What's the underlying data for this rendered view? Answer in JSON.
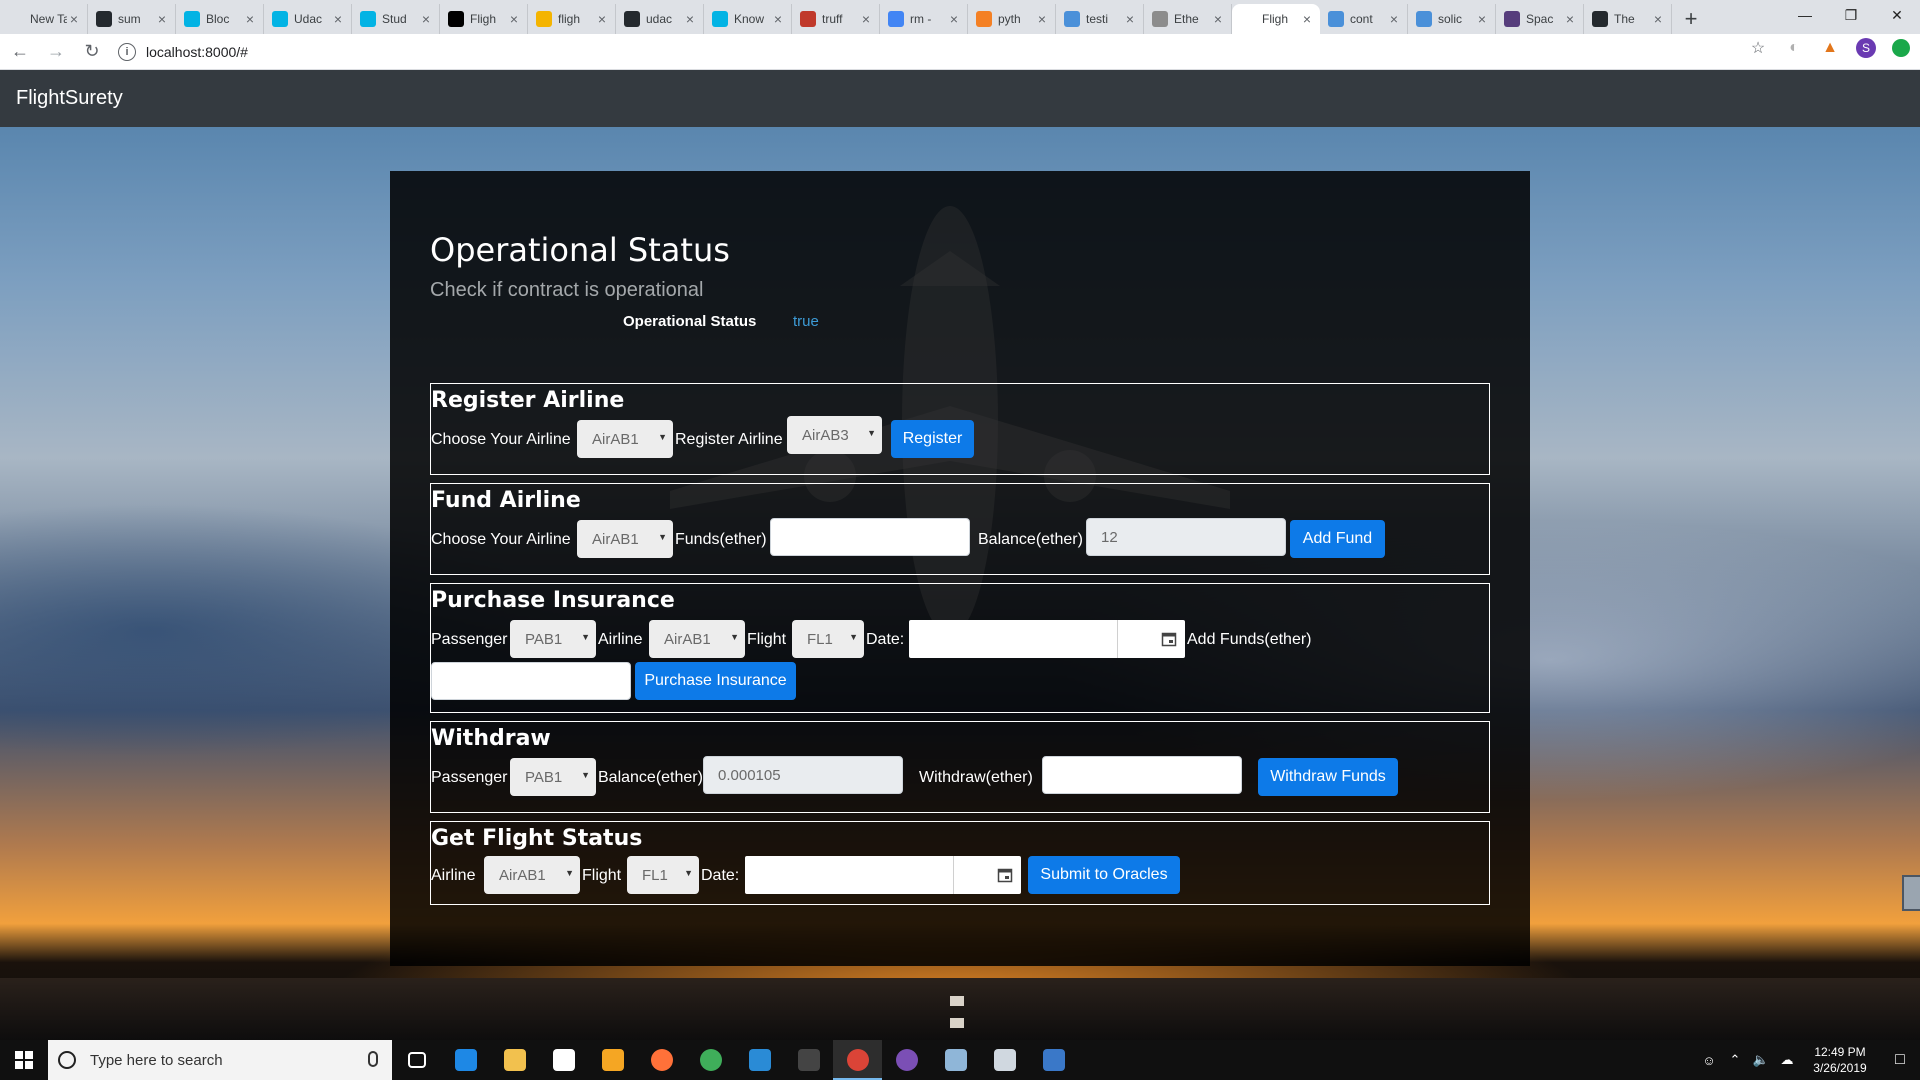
{
  "browser": {
    "tabs": [
      {
        "label": "New Tab",
        "icon": "new-tab-icon",
        "color": "#dee1e6"
      },
      {
        "label": "sum",
        "icon": "github-icon",
        "color": "#24292e"
      },
      {
        "label": "Bloc",
        "icon": "udacity-icon",
        "color": "#02b3e4"
      },
      {
        "label": "Udac",
        "icon": "udacity-icon",
        "color": "#02b3e4"
      },
      {
        "label": "Stud",
        "icon": "udacity-icon",
        "color": "#02b3e4"
      },
      {
        "label": "Fligh",
        "icon": "medium-icon",
        "color": "#000000"
      },
      {
        "label": "fligh",
        "icon": "google-drive-icon",
        "color": "#f4b400"
      },
      {
        "label": "udac",
        "icon": "github-icon",
        "color": "#24292e"
      },
      {
        "label": "Know",
        "icon": "udacity-icon",
        "color": "#02b3e4"
      },
      {
        "label": "truff",
        "icon": "truffle-icon",
        "color": "#c0392b"
      },
      {
        "label": "rm -",
        "icon": "google-icon",
        "color": "#4285f4"
      },
      {
        "label": "pyth",
        "icon": "stackoverflow-icon",
        "color": "#f48024"
      },
      {
        "label": "testi",
        "icon": "ethereum-stackexchange-icon",
        "color": "#4a90d9"
      },
      {
        "label": "Ethe",
        "icon": "ethereum-icon",
        "color": "#8c8c8c"
      },
      {
        "label": "Fligh",
        "icon": "page-icon",
        "color": "#ffffff",
        "active": true
      },
      {
        "label": "cont",
        "icon": "ethereum-stackexchange-icon",
        "color": "#4a90d9"
      },
      {
        "label": "solic",
        "icon": "ethereum-stackexchange-icon",
        "color": "#4a90d9"
      },
      {
        "label": "Spac",
        "icon": "bootstrap-icon",
        "color": "#563d7c"
      },
      {
        "label": "The",
        "icon": "github-icon",
        "color": "#24292e"
      }
    ],
    "url": "localhost:8000/#",
    "profile_initial": "S"
  },
  "app": {
    "brand": "FlightSurety"
  },
  "status": {
    "title": "Operational Status",
    "subtitle": "Check if contract is operational",
    "label": "Operational Status",
    "value": "true"
  },
  "register": {
    "title": "Register Airline",
    "choose_label": "Choose Your Airline",
    "choose_value": "AirAB1",
    "register_label": "Register Airline",
    "register_value": "AirAB3",
    "button": "Register"
  },
  "fund": {
    "title": "Fund Airline",
    "choose_label": "Choose Your Airline",
    "choose_value": "AirAB1",
    "funds_label": "Funds(ether)",
    "funds_value": "",
    "balance_label": "Balance(ether)",
    "balance_value": "12",
    "button": "Add Fund"
  },
  "purchase": {
    "title": "Purchase Insurance",
    "passenger_label": "Passenger",
    "passenger_value": "PAB1",
    "airline_label": "Airline",
    "airline_value": "AirAB1",
    "flight_label": "Flight",
    "flight_value": "FL1",
    "date_label": "Date:",
    "add_funds_label": "Add Funds(ether)",
    "button": "Purchase Insurance"
  },
  "withdraw": {
    "title": "Withdraw",
    "passenger_label": "Passenger",
    "passenger_value": "PAB1",
    "balance_label": "Balance(ether)",
    "balance_value": "0.000105",
    "withdraw_label": "Withdraw(ether)",
    "button": "Withdraw Funds"
  },
  "flight_status": {
    "title": "Get Flight Status",
    "airline_label": "Airline",
    "airline_value": "AirAB1",
    "flight_label": "Flight",
    "flight_value": "FL1",
    "date_label": "Date:",
    "button": "Submit to Oracles"
  },
  "taskbar": {
    "search_placeholder": "Type here to search",
    "apps": [
      {
        "name": "task-view-icon",
        "color": "#ffffff"
      },
      {
        "name": "edge-icon",
        "color": "#1e88e5"
      },
      {
        "name": "file-explorer-icon",
        "color": "#f2c14e"
      },
      {
        "name": "store-icon",
        "color": "#ffffff"
      },
      {
        "name": "media-player-icon",
        "color": "#f5a623"
      },
      {
        "name": "firefox-icon",
        "color": "#ff7139"
      },
      {
        "name": "globe-app-icon",
        "color": "#3fae5a"
      },
      {
        "name": "vscode-icon",
        "color": "#2a8bd6"
      },
      {
        "name": "terminal-icon",
        "color": "#444444"
      },
      {
        "name": "chrome-icon",
        "color": "#db4437",
        "active": true
      },
      {
        "name": "purple-app-icon",
        "color": "#7b4fb5"
      },
      {
        "name": "note-app-icon",
        "color": "#8fb6d8"
      },
      {
        "name": "calculator-app-icon",
        "color": "#d0d8e0"
      },
      {
        "name": "remote-desktop-icon",
        "color": "#3a78c8"
      }
    ],
    "time": "12:49 PM",
    "date": "3/26/2019"
  }
}
